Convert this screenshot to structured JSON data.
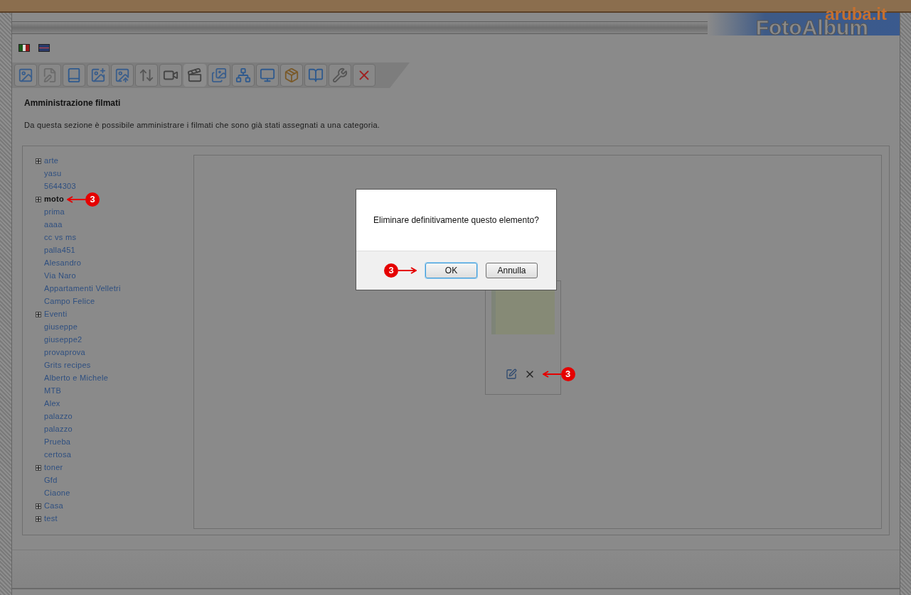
{
  "header": {
    "brand": "aruba.it",
    "product": "FotoAlbum"
  },
  "languages": [
    {
      "kind": "italian",
      "selected": false
    },
    {
      "kind": "english",
      "selected": false
    }
  ],
  "toolbar": [
    {
      "selected": false
    },
    {
      "selected": false
    },
    {
      "selected": false
    },
    {
      "selected": false
    },
    {
      "selected": false
    },
    {
      "selected": false
    },
    {
      "selected": false
    },
    {
      "selected": true
    },
    {
      "selected": false
    },
    {
      "selected": false
    },
    {
      "selected": false
    },
    {
      "selected": false
    },
    {
      "selected": false
    },
    {
      "selected": false
    },
    {
      "selected": false
    }
  ],
  "page": {
    "title": "Amministrazione filmati",
    "description": "Da questa sezione è possibile amministrare i filmati che sono già stati assegnati a una categoria."
  },
  "categories": [
    {
      "label": "arte",
      "kind": "group",
      "expanded": false,
      "selected": false
    },
    {
      "label": "yasu",
      "kind": "item",
      "selected": false
    },
    {
      "label": "5644303",
      "kind": "item",
      "selected": false
    },
    {
      "label": "moto",
      "kind": "group",
      "expanded": false,
      "selected": true
    },
    {
      "label": "prima",
      "kind": "item",
      "selected": false
    },
    {
      "label": "aaaa",
      "kind": "item",
      "selected": false
    },
    {
      "label": "cc vs ms",
      "kind": "item",
      "selected": false
    },
    {
      "label": "palla451",
      "kind": "item",
      "selected": false
    },
    {
      "label": "Alesandro",
      "kind": "item",
      "selected": false
    },
    {
      "label": "Via Naro",
      "kind": "item",
      "selected": false
    },
    {
      "label": "Appartamenti Velletri",
      "kind": "item",
      "selected": false
    },
    {
      "label": "Campo Felice",
      "kind": "item",
      "selected": false
    },
    {
      "label": "Eventi",
      "kind": "group",
      "expanded": false,
      "selected": false
    },
    {
      "label": "giuseppe",
      "kind": "item",
      "selected": false
    },
    {
      "label": "giuseppe2",
      "kind": "item",
      "selected": false
    },
    {
      "label": "provaprova",
      "kind": "item",
      "selected": false
    },
    {
      "label": "Grits recipes",
      "kind": "item",
      "selected": false
    },
    {
      "label": "Alberto e Michele",
      "kind": "item",
      "selected": false
    },
    {
      "label": "MTB",
      "kind": "item",
      "selected": false
    },
    {
      "label": "Alex",
      "kind": "item",
      "selected": false
    },
    {
      "label": "palazzo",
      "kind": "item",
      "selected": false
    },
    {
      "label": "palazzo",
      "kind": "item",
      "selected": false
    },
    {
      "label": "Prueba",
      "kind": "item",
      "selected": false
    },
    {
      "label": "certosa",
      "kind": "item",
      "selected": false
    },
    {
      "label": "toner",
      "kind": "group",
      "expanded": false,
      "selected": false
    },
    {
      "label": "Gfd",
      "kind": "item",
      "selected": false
    },
    {
      "label": "Ciaone",
      "kind": "item",
      "selected": false
    },
    {
      "label": "Casa",
      "kind": "group",
      "expanded": false,
      "selected": false
    },
    {
      "label": "test",
      "kind": "group",
      "expanded": false,
      "selected": false
    }
  ],
  "dialog": {
    "message": "Eliminare definitivamente questo elemento?",
    "buttons": [
      {
        "label": "OK",
        "focused": true
      },
      {
        "label": "Annulla",
        "focused": false
      }
    ]
  },
  "callouts": [
    {
      "label": "3"
    },
    {
      "label": "3"
    },
    {
      "label": "3"
    }
  ]
}
